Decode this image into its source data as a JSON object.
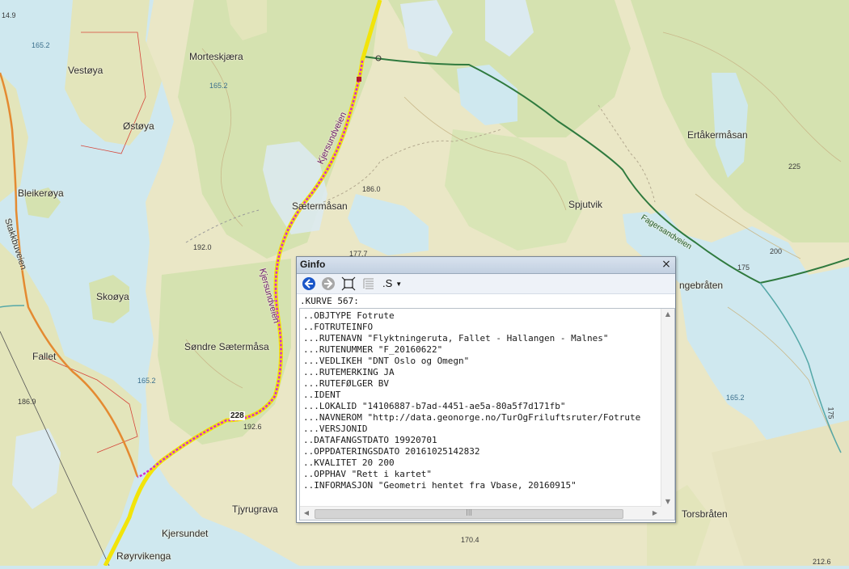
{
  "map": {
    "places": {
      "vestoya": "Vestøya",
      "morteskjaera": "Morteskjæra",
      "ostoya": "Østøya",
      "bleikeroya": "Bleikerøya",
      "skooya": "Skoøya",
      "fallet": "Fallet",
      "saetermasan": "Sætermåsan",
      "sondre_saetermasa": "Søndre Sætermåsa",
      "ertakermasan": "Ertåkermåsan",
      "spjutvik": "Spjutvik",
      "ngebraten": "ngebråten",
      "torsbraten": "Torsbråten",
      "kjersundet": "Kjersundet",
      "royrvikenga": "Røyrvikenga",
      "tjyrugrava": "Tjyrugrava"
    },
    "roads": {
      "kjersundveien": "Kjersundveien",
      "stakkbuveien": "Stakkbuveien",
      "fagersandveien": "Fagersandveien",
      "route_number": "228"
    },
    "elevations": {
      "e1": "165.2",
      "e2": "165.2",
      "e3": "165.2",
      "e4": "165.2",
      "e5": "186.0",
      "e6": "192.0",
      "e7": "192.6",
      "e8": "186.9",
      "e9": "170.4",
      "e10": "212.6",
      "e11": "177.7",
      "c225": "225",
      "c200": "200",
      "c175a": "175",
      "c175b": "175",
      "c14": "14.9"
    }
  },
  "ginfo": {
    "title": "Ginfo",
    "close": "×",
    "toolbar": {
      "s_menu": ".S"
    },
    "kurve": ".KURVE 567:",
    "lines": [
      "..OBJTYPE Fotrute",
      "..FOTRUTEINFO",
      "...RUTENAVN \"Flyktningeruta, Fallet - Hallangen - Malnes\"",
      "...RUTENUMMER \"F_20160622\"",
      "...VEDLIKEH \"DNT Oslo og Omegn\"",
      "...RUTEMERKING JA",
      "...RUTEFØLGER BV",
      "..IDENT",
      "...LOKALID \"14106887-b7ad-4451-ae5a-80a5f7d171fb\"",
      "...NAVNEROM \"http://data.geonorge.no/TurOgFriluftsruter/Fotrute",
      "...VERSJONID",
      "..DATAFANGSTDATO 19920701",
      "..OPPDATERINGSDATO 20161025142832",
      "..KVALITET 20 200",
      "..OPPHAV \"Rett i kartet\"",
      "..INFORMASJON \"Geometri hentet fra Vbase, 20160915\""
    ]
  }
}
